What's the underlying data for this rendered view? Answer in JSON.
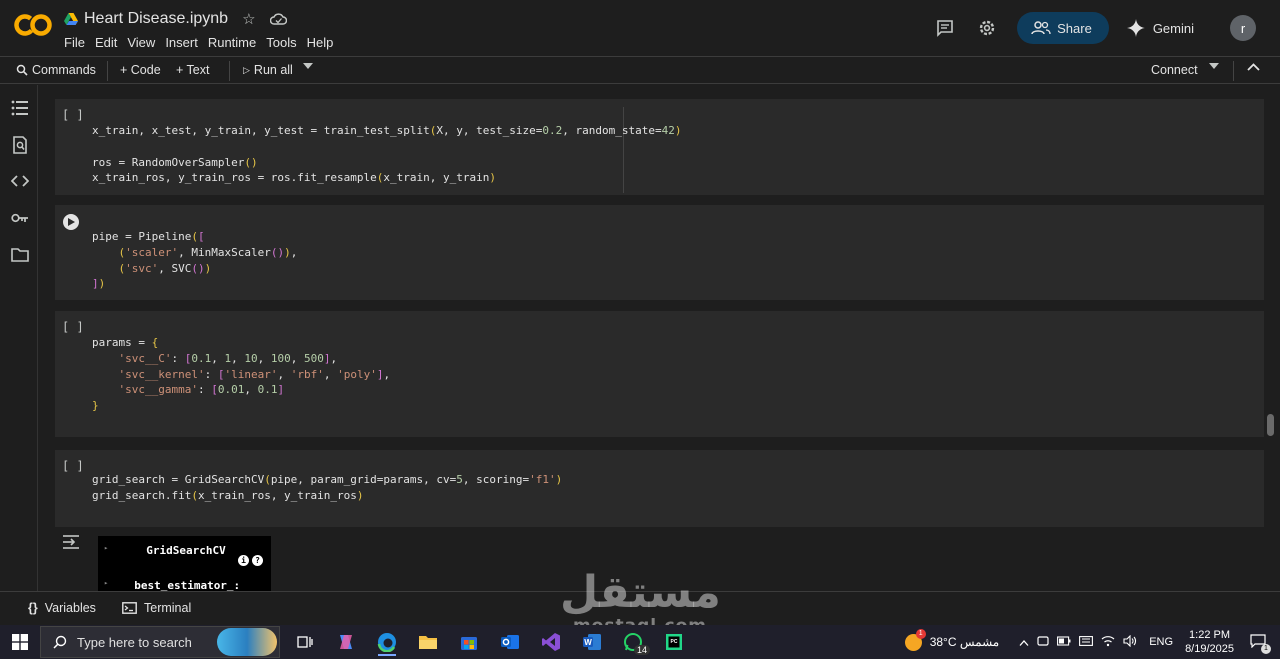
{
  "header": {
    "title": "Heart Disease.ipynb",
    "menu": [
      "File",
      "Edit",
      "View",
      "Insert",
      "Runtime",
      "Tools",
      "Help"
    ],
    "share_label": "Share",
    "gemini_label": "Gemini",
    "avatar_letter": "r"
  },
  "toolbar": {
    "commands_label": "Commands",
    "code_label": "+ Code",
    "text_label": "+ Text",
    "run_all_label": "Run all",
    "connect_label": "Connect"
  },
  "cells": [
    {
      "gutter": "[ ]"
    },
    {
      "gutter": ""
    },
    {
      "gutter": "[ ]"
    },
    {
      "gutter": "[ ]"
    }
  ],
  "output": {
    "widget_title": "GridSearchCV",
    "best_estimator": "best_estimator_:"
  },
  "bottom_bar": {
    "variables_label": "Variables",
    "terminal_label": "Terminal"
  },
  "watermark": {
    "arabic": "مستقل",
    "latin": "mostaql.com"
  },
  "taskbar": {
    "search_placeholder": "Type here to search",
    "whatsapp_badge": "14",
    "weather_badge": "1",
    "weather": "38°C مشمس",
    "language": "ENG",
    "time": "1:22 PM",
    "date": "8/19/2025",
    "notification_badge": "1"
  },
  "colors": {
    "share_bg": "#0e3c5c",
    "string": "#ce9178",
    "number": "#b5cea8",
    "bracket": "#e6c547",
    "logo_orange": "#f9ab00"
  }
}
